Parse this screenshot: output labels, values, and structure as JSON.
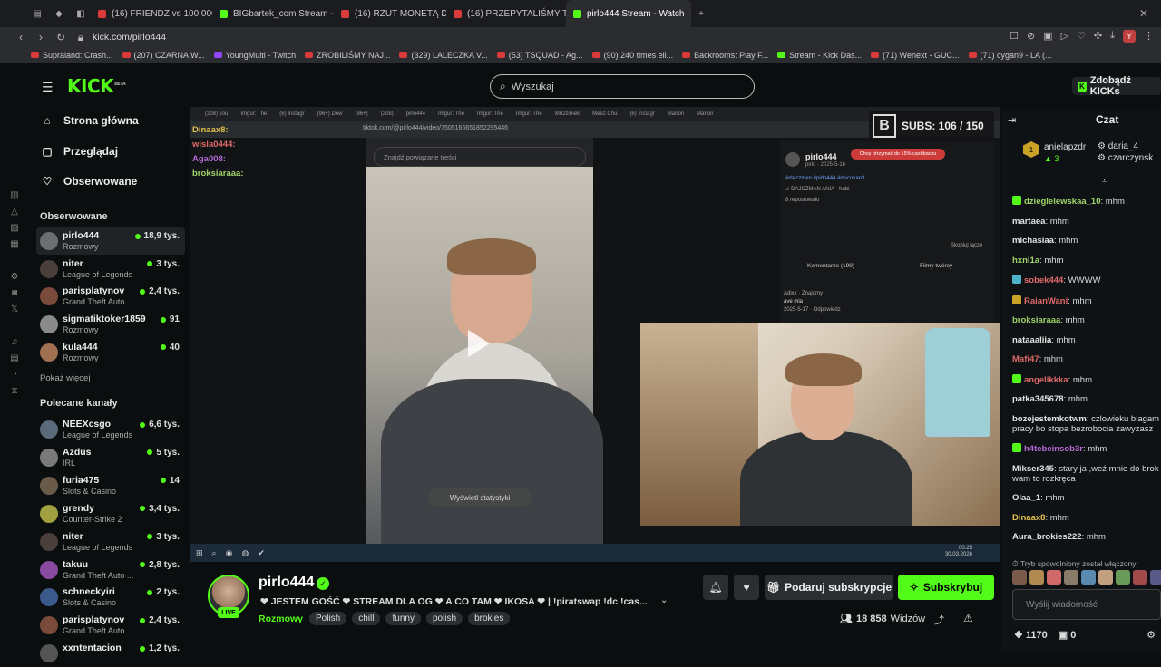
{
  "browser": {
    "tabs": [
      {
        "label": "(208) you",
        "color": "#d93a3a"
      },
      {
        "label": "(16) FRIENDZ vs 100,000",
        "color": "#d93a3a"
      },
      {
        "label": "BIGbartek_com Stream -",
        "color": "#53fc18"
      },
      {
        "label": "(16) RZUT MONETĄ DECY",
        "color": "#d93a3a"
      },
      {
        "label": "(16) PRZEPYTALIŚMY TO",
        "color": "#d93a3a"
      },
      {
        "label": "pirlo444 Stream - Watch",
        "color": "#53fc18",
        "active": true
      }
    ],
    "url": "kick.com/pirlo444",
    "profile_initial": "Y",
    "bookmarks": [
      {
        "label": "Supraland: Crash...",
        "color": "#d93a3a"
      },
      {
        "label": "(207) CZARNA W...",
        "color": "#d93a3a"
      },
      {
        "label": "YoungMulti - Twitch",
        "color": "#9146ff"
      },
      {
        "label": "ZROBILIŚMY NAJ...",
        "color": "#d93a3a"
      },
      {
        "label": "(329) LALECZKA V...",
        "color": "#d93a3a"
      },
      {
        "label": "(53) TSQUAD - Ag...",
        "color": "#d93a3a"
      },
      {
        "label": "(90) 240 times eli...",
        "color": "#d93a3a"
      },
      {
        "label": "Backrooms: Play F...",
        "color": "#d93a3a"
      },
      {
        "label": "Stream - Kick Das...",
        "color": "#53fc18"
      },
      {
        "label": "(71) Wenext - GUC...",
        "color": "#d93a3a"
      },
      {
        "label": "(71) cygan9 - LA (...",
        "color": "#d93a3a"
      }
    ]
  },
  "header": {
    "logo": "KICK",
    "logo_sup": "BETA",
    "search_placeholder": "Wyszukaj",
    "get_kicks": "Zdobądź KICKs"
  },
  "sidebar": {
    "nav": [
      {
        "label": "Strona główna",
        "icon": "home-icon"
      },
      {
        "label": "Przeglądaj",
        "icon": "browse-icon"
      },
      {
        "label": "Obserwowane",
        "icon": "heart-icon"
      }
    ],
    "followed_title": "Obserwowane",
    "followed": [
      {
        "name": "pirlo444",
        "category": "Rozmowy",
        "viewers": "18,9 tys.",
        "avatar": "#6b6f73"
      },
      {
        "name": "niter",
        "category": "League of Legends",
        "viewers": "3 tys.",
        "avatar": "#4a3f3a"
      },
      {
        "name": "parisplatynov",
        "category": "Grand Theft Auto ...",
        "viewers": "2,4 tys.",
        "avatar": "#7a4a3a"
      },
      {
        "name": "sigmatiktoker1859",
        "category": "Rozmowy",
        "viewers": "91",
        "avatar": "#8a8a8a"
      },
      {
        "name": "kula444",
        "category": "Rozmowy",
        "viewers": "40",
        "avatar": "#a07050"
      }
    ],
    "show_more": "Pokaż więcej",
    "recommended_title": "Polecane kanały",
    "recommended": [
      {
        "name": "NEEXcsgo",
        "category": "League of Legends",
        "viewers": "6,6 tys.",
        "avatar": "#5a6a7a"
      },
      {
        "name": "Azdus",
        "category": "IRL",
        "viewers": "5 tys.",
        "avatar": "#7a7a7a"
      },
      {
        "name": "furia475",
        "category": "Slots & Casino",
        "viewers": "14",
        "avatar": "#6a5a4a"
      },
      {
        "name": "grendy",
        "category": "Counter-Strike 2",
        "viewers": "3,4 tys.",
        "avatar": "#a0a040"
      },
      {
        "name": "niter",
        "category": "League of Legends",
        "viewers": "3 tys.",
        "avatar": "#4a3f3a"
      },
      {
        "name": "takuu",
        "category": "Grand Theft Auto ...",
        "viewers": "2,8 tys.",
        "avatar": "#8a4aa0"
      },
      {
        "name": "schneckyiri",
        "category": "Slots & Casino",
        "viewers": "2 tys.",
        "avatar": "#3a5a8a"
      },
      {
        "name": "parisplatynov",
        "category": "Grand Theft Auto ...",
        "viewers": "2,4 tys.",
        "avatar": "#7a4a3a"
      },
      {
        "name": "xxntentacion",
        "category": "",
        "viewers": "1,2 tys.",
        "avatar": "#555"
      }
    ]
  },
  "video": {
    "subs_logo": "B",
    "subs_label": "SUBS: 106 / 150",
    "overlay_chat": [
      {
        "user": "Dinaax8:",
        "cls": "u1"
      },
      {
        "user": "wisla0444:",
        "cls": "u2"
      },
      {
        "user": "Aga008:",
        "cls": "u3"
      },
      {
        "user": "broksiaraaa:",
        "cls": "u4"
      }
    ],
    "inner_url": "tiktok.com/@pirlo444/video/7505166651852295446",
    "inner_search": "Znajdź powiązane treści",
    "inner_stats": "Wyświetl statystyki",
    "inner_name": "pirlo444",
    "inner_date": "pirlo · 2025-5-16",
    "inner_promo": "Chcę otrzymać do 15% cashbacku",
    "inner_tags": "#dajczmen #pirlo444 #discokarol",
    "inner_song": "♫ DAJCZMAN ANIA - hubi",
    "inner_reposts": "8 repostowało",
    "inner_link_btn": "Skopiuj łącze",
    "inner_comments_tab": "Komentarze (199)",
    "inner_creator_tab": "Filmy twórcy",
    "inner_comment": "Adixx · Znajomy",
    "inner_comment_text": "ave mia",
    "inner_comment_meta": "2025-5-17 · Odpowiedz",
    "inner_time": "00:25",
    "inner_date2": "30.03.2026",
    "inner_tabs": [
      "(208) you",
      "Imgur: The",
      "(6) Instagr",
      "(96+) Dew",
      "(96+)",
      "(208)",
      "pirlo444",
      "Imgur: The",
      "Imgur: The",
      "Imgur: The",
      "MrOzimek",
      "Meez Chu",
      "(6) Instagr",
      "Marion",
      "Marion"
    ]
  },
  "stream": {
    "name": "pirlo444",
    "title": "❤ JESTEM GOŚĆ ❤ STREAM DLA OG ❤ A CO TAM ❤ IKOSA ❤ | !piratswap !dc !cas...",
    "category": "Rozmowy",
    "tags": [
      "Polish",
      "chill",
      "funny",
      "polish",
      "brokies"
    ],
    "live": "LIVE",
    "gift_label": "Podaruj subskrypcje",
    "subscribe_label": "Subskrybuj",
    "viewers": "18 858",
    "viewers_suffix": "Widzów"
  },
  "chat": {
    "title": "Czat",
    "pinned": {
      "user1": "anielapzdr",
      "count1": "3",
      "user2": "daria_4",
      "user3": "czarczynsk"
    },
    "messages": [
      {
        "user": "dzieglelewskaa_10",
        "text": "mhm",
        "color": "#9fd36a",
        "badge": "#53fc18"
      },
      {
        "user": "martaea",
        "text": "mhm",
        "color": "#e2e2e2"
      },
      {
        "user": "michasiaa",
        "text": "mhm",
        "color": "#e2e2e2"
      },
      {
        "user": "hxni1a",
        "text": "mhm",
        "color": "#9fd36a"
      },
      {
        "user": "sobek444",
        "text": "WWWW",
        "color": "#e06a6a",
        "badge": "#4ab3c9"
      },
      {
        "user": "RaianWani",
        "text": "mhm",
        "color": "#e06a6a",
        "badge": "#c9a227"
      },
      {
        "user": "broksiaraaa",
        "text": "mhm",
        "color": "#9fd36a"
      },
      {
        "user": "nataaaliia",
        "text": "mhm",
        "color": "#e2e2e2"
      },
      {
        "user": "Mafi47",
        "text": "mhm",
        "color": "#e06a6a"
      },
      {
        "user": "angelikkka",
        "text": "mhm",
        "color": "#e06a6a",
        "badge": "#53fc18"
      },
      {
        "user": "patka345678",
        "text": "mhm",
        "color": "#e2e2e2"
      },
      {
        "user": "bozejestemkotwm",
        "text": "czlowieku blagam pracy bo stopa bezrobocia zawyzasz",
        "color": "#e2e2e2"
      },
      {
        "user": "h4tebeinsob3r",
        "text": "mhm",
        "color": "#b46ad6",
        "badge": "#53fc18"
      },
      {
        "user": "Mikser345",
        "text": "stary ja ,weź mnie do brok wam to rozkręca",
        "color": "#e2e2e2"
      },
      {
        "user": "Olaa_1",
        "text": "mhm",
        "color": "#e2e2e2"
      },
      {
        "user": "Dinaax8",
        "text": "mhm",
        "color": "#e2c14f"
      },
      {
        "user": "Aura_brokies222",
        "text": "mhm",
        "color": "#e2e2e2"
      }
    ],
    "slow_mode": "Tryb spowolniony został włączony",
    "input_placeholder": "Wyślij wiadomość",
    "kicks_count": "1170",
    "gifts_count": "0"
  },
  "colors": {
    "accent": "#53fc18",
    "background": "#0b0e0f"
  }
}
